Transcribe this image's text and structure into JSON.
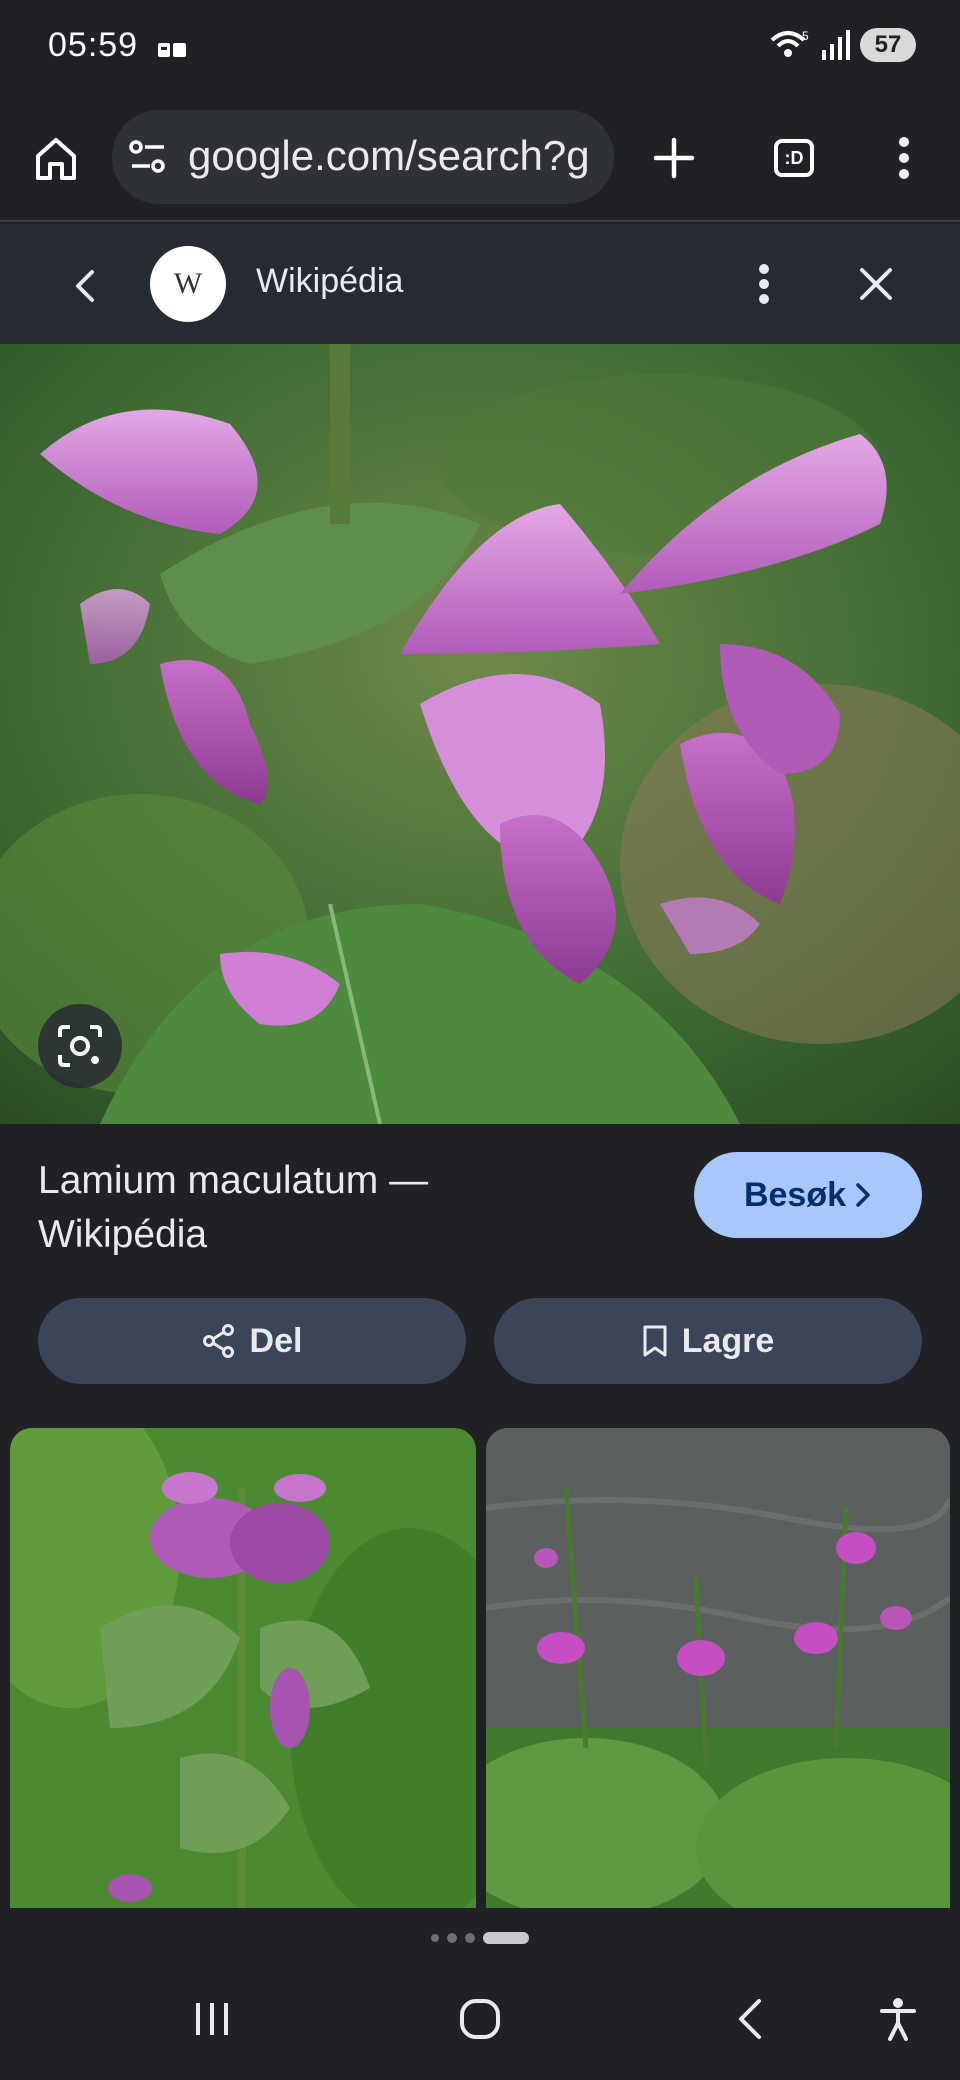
{
  "status": {
    "time": "05:59",
    "battery": "57",
    "network_tag": "5"
  },
  "browser": {
    "url": "google.com/search?g",
    "tabs_icon_label": ":D"
  },
  "source": {
    "logo_letter": "W",
    "name": "Wikipédia"
  },
  "result": {
    "title": "Lamium maculatum — Wikipédia",
    "visit_label": "Besøk",
    "share_label": "Del",
    "save_label": "Lagre"
  },
  "icons": {
    "home": "home-icon",
    "site-settings": "tune-icon",
    "new-tab": "plus-icon",
    "tabs": "tab-switcher-icon",
    "menu": "more-vert-icon",
    "back": "chevron-left-icon",
    "close": "close-icon",
    "lens": "google-lens-icon",
    "share": "share-icon",
    "bookmark": "bookmark-icon"
  },
  "pager": {
    "count": 4,
    "active_index": 3
  },
  "colors": {
    "background": "#1f2125",
    "header": "#262a33",
    "accent_button": "#a8c7fa",
    "action_button": "#3b4558"
  }
}
